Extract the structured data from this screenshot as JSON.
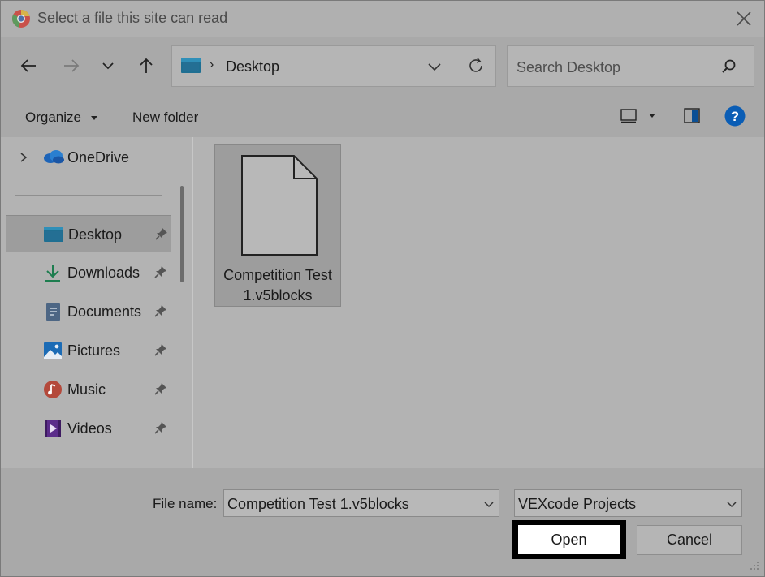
{
  "window": {
    "title": "Select a file this site can read",
    "app_icon": "chrome-icon"
  },
  "nav": {
    "back_icon": "arrow-left-icon",
    "forward_icon": "arrow-right-icon",
    "recent_icon": "chevron-down-icon",
    "up_icon": "arrow-up-icon"
  },
  "address": {
    "location_icon": "desktop-folder-icon",
    "separator": "›",
    "path": "Desktop",
    "refresh_icon": "refresh-icon"
  },
  "search": {
    "placeholder": "Search Desktop",
    "icon": "search-icon"
  },
  "toolbar": {
    "organize_label": "Organize",
    "new_folder_label": "New folder",
    "view_icon": "view-mode-icon",
    "preview_icon": "preview-pane-icon",
    "help_icon": "help-icon"
  },
  "sidebar": {
    "items": [
      {
        "label": "OneDrive",
        "icon": "onedrive-icon",
        "expandable": true
      },
      {
        "label": "Desktop",
        "icon": "desktop-folder-icon",
        "pinned": true,
        "selected": true
      },
      {
        "label": "Downloads",
        "icon": "downloads-icon",
        "pinned": true
      },
      {
        "label": "Documents",
        "icon": "documents-icon",
        "pinned": true
      },
      {
        "label": "Pictures",
        "icon": "pictures-icon",
        "pinned": true
      },
      {
        "label": "Music",
        "icon": "music-icon",
        "pinned": true
      },
      {
        "label": "Videos",
        "icon": "videos-icon",
        "pinned": true
      }
    ]
  },
  "files": [
    {
      "name": "Competition Test 1.v5blocks",
      "icon": "generic-file-icon",
      "selected": true
    }
  ],
  "footer": {
    "file_name_label": "File name:",
    "file_name_value": "Competition Test 1.v5blocks",
    "file_type_value": "VEXcode Projects",
    "open_label": "Open",
    "cancel_label": "Cancel"
  },
  "colors": {
    "dim_background": "#b3b3b3",
    "help_blue": "#0a5db5",
    "open_focus_border": "#000000"
  }
}
